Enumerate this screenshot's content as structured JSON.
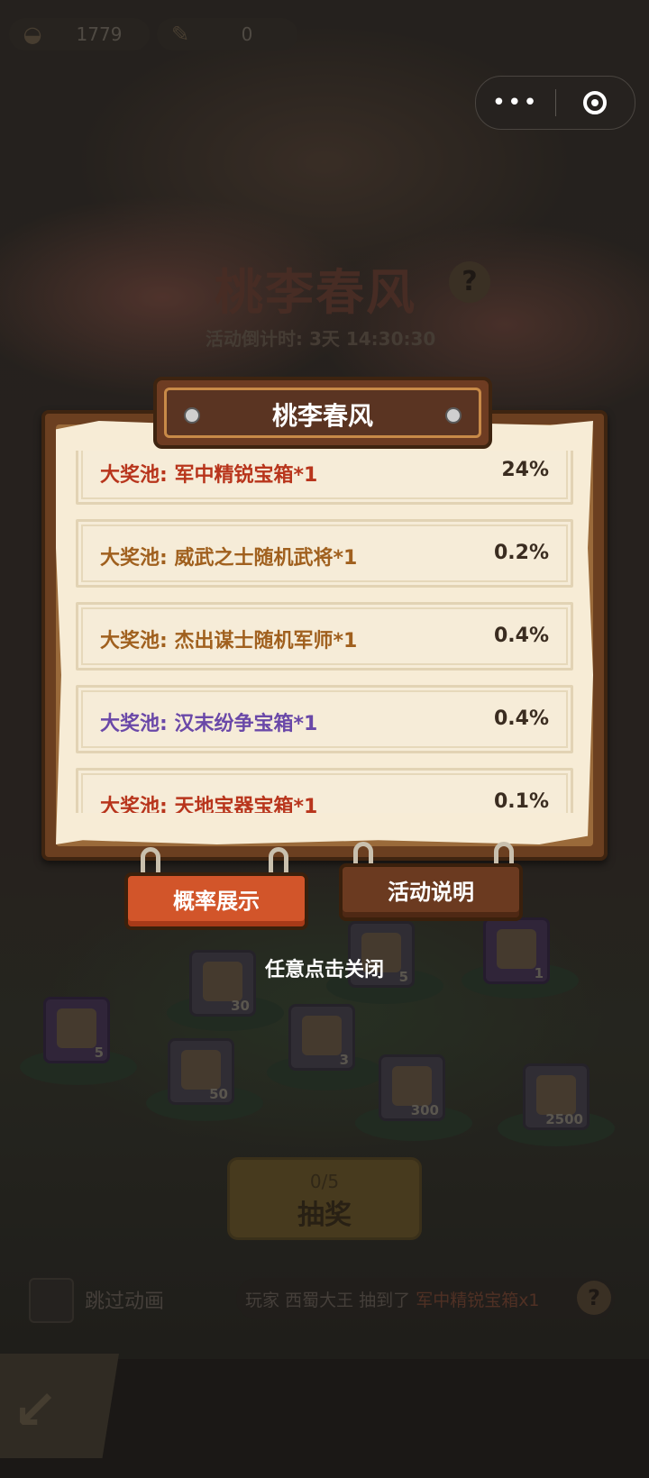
{
  "currency": [
    {
      "icon": "ingot-icon",
      "value": "1779"
    },
    {
      "icon": "scroll-token-icon",
      "value": "0"
    }
  ],
  "background": {
    "title": "桃李春风",
    "countdown": "活动倒计时: 3天 14:30:30",
    "items": [
      {
        "q": "5"
      },
      {
        "q": "30"
      },
      {
        "q": "5"
      },
      {
        "q": "1"
      },
      {
        "q": "3"
      },
      {
        "q": "50"
      },
      {
        "q": "300"
      },
      {
        "q": "2500"
      }
    ],
    "draw_count": "0/5",
    "draw_label": "抽奖",
    "skip_label": "跳过动画",
    "ticker": {
      "prefix": "玩家",
      "player": "西蜀大王",
      "verb": "抽到了",
      "prize": "军中精锐宝箱x1"
    }
  },
  "modal": {
    "title": "桃李春风",
    "rows": [
      {
        "name": "大奖池: 军中精锐宝箱*1",
        "pct": "24%",
        "color": "red"
      },
      {
        "name": "大奖池: 威武之士随机武将*1",
        "pct": "0.2%",
        "color": "brown"
      },
      {
        "name": "大奖池: 杰出谋士随机军师*1",
        "pct": "0.4%",
        "color": "brown"
      },
      {
        "name": "大奖池: 汉末纷争宝箱*1",
        "pct": "0.4%",
        "color": "purple"
      },
      {
        "name": "大奖池: 天地宝器宝箱*1",
        "pct": "0.1%",
        "color": "red"
      }
    ],
    "tabs": {
      "probability": "概率展示",
      "rules": "活动说明"
    },
    "close_hint": "任意点击关闭"
  }
}
